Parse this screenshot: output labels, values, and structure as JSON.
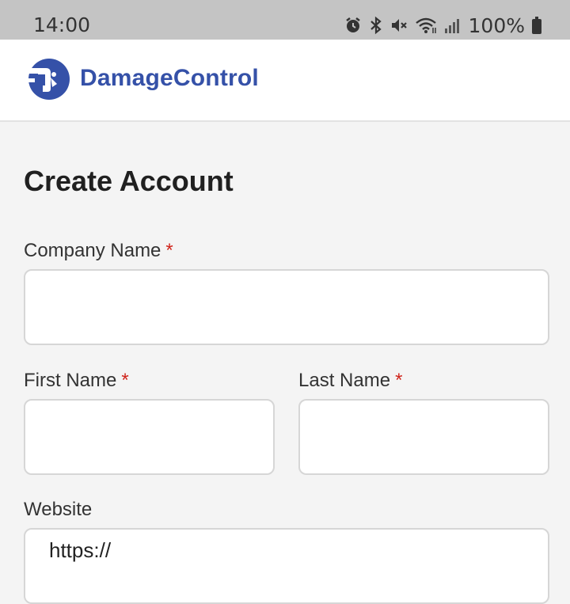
{
  "status_bar": {
    "time": "14:00",
    "battery": "100%",
    "icons": [
      "alarm-icon",
      "bluetooth-icon",
      "mute-icon",
      "wifi-icon",
      "signal-icon",
      "battery-icon"
    ]
  },
  "header": {
    "brand": "DamageControl",
    "brand_color": "#3551a8"
  },
  "form": {
    "title": "Create Account",
    "required_marker": "*",
    "company_name": {
      "label": "Company Name",
      "value": ""
    },
    "first_name": {
      "label": "First Name",
      "value": ""
    },
    "last_name": {
      "label": "Last Name",
      "value": ""
    },
    "website": {
      "label": "Website",
      "value": "https://"
    }
  },
  "colors": {
    "required": "#d0241b",
    "background": "#f4f4f4"
  }
}
